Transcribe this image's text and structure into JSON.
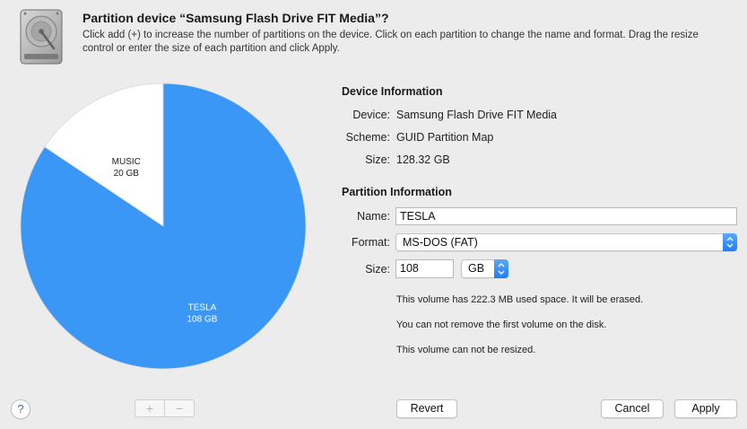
{
  "dialog": {
    "title": "Partition device “Samsung Flash Drive FIT Media”?",
    "description": "Click add (+) to increase the number of partitions on the device. Click on each partition to change the name and format. Drag the resize control or enter the size of each partition and click Apply.",
    "icon": "hard-disk-icon"
  },
  "chart_data": {
    "type": "pie",
    "slices": [
      {
        "name": "MUSIC",
        "label": "20 GB",
        "value": 20,
        "color": "#ffffff"
      },
      {
        "name": "TESLA",
        "label": "108 GB",
        "value": 108,
        "color": "#3a97f5"
      }
    ]
  },
  "device_info": {
    "heading": "Device Information",
    "device_label": "Device:",
    "device_value": "Samsung Flash Drive FIT Media",
    "scheme_label": "Scheme:",
    "scheme_value": "GUID Partition Map",
    "size_label": "Size:",
    "size_value": "128.32 GB"
  },
  "partition_info": {
    "heading": "Partition Information",
    "name_label": "Name:",
    "name_value": "TESLA",
    "format_label": "Format:",
    "format_value": "MS-DOS (FAT)",
    "size_label": "Size:",
    "size_value": "108",
    "unit_value": "GB"
  },
  "notes": [
    "This volume has 222.3 MB used space. It will be erased.",
    "You can not remove the first volume on the disk.",
    "This volume can not be resized."
  ],
  "footer": {
    "help_label": "?",
    "add_label": "+",
    "remove_label": "−",
    "revert_label": "Revert",
    "cancel_label": "Cancel",
    "apply_label": "Apply"
  },
  "colors": {
    "accent": "#1f7ef4",
    "tesla_slice": "#3a97f5",
    "music_slice": "#ffffff"
  }
}
